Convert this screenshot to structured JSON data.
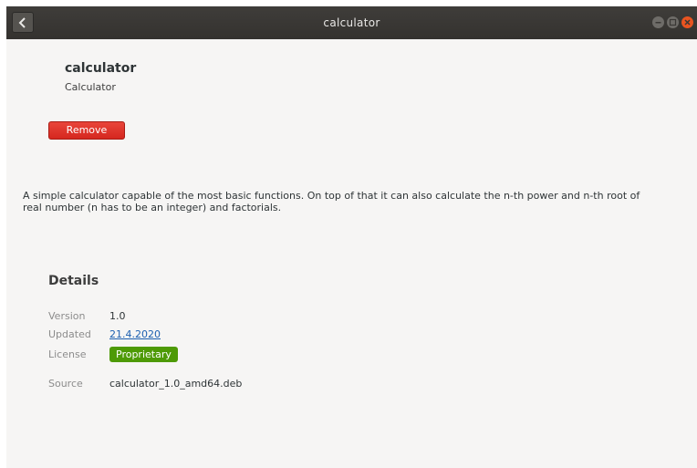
{
  "window": {
    "title": "calculator"
  },
  "app": {
    "name": "calculator",
    "summary": "Calculator",
    "remove_label": "Remove",
    "description": "A simple calculator capable of the most basic functions. On top of that it can also calculate the n-th power and n-th root of real number (n has to be an integer) and factorials."
  },
  "details": {
    "heading": "Details",
    "version_label": "Version",
    "version_value": "1.0",
    "updated_label": "Updated",
    "updated_value": "21.4.2020",
    "license_label": "License",
    "license_value": "Proprietary",
    "source_label": "Source",
    "source_value": "calculator_1.0_amd64.deb"
  },
  "icons": {
    "back": "chevron-left-icon",
    "minimize": "minimize-icon",
    "maximize": "maximize-icon",
    "close": "close-icon"
  },
  "colors": {
    "titlebar": "#3a3835",
    "remove_button": "#e0352b",
    "license_badge": "#4e9a06",
    "link": "#1c5fb0",
    "close_button": "#e95420"
  }
}
